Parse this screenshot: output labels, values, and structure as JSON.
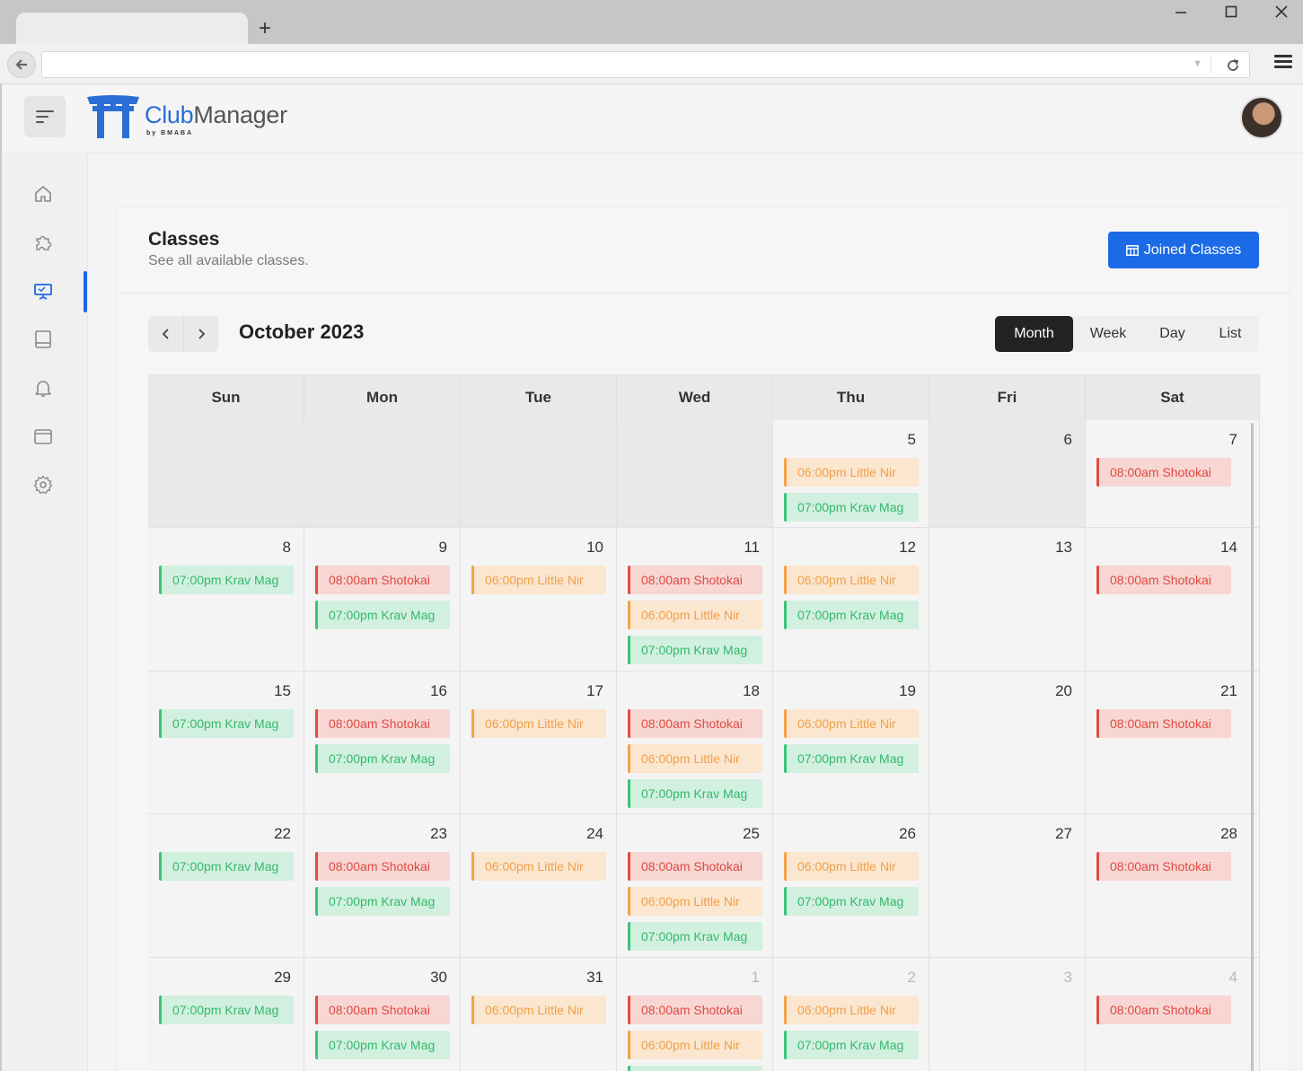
{
  "browser": {
    "new_tab": "+",
    "win_minimize": "—",
    "win_maximize": "☐",
    "win_close": "✕"
  },
  "app": {
    "logo_club": "Club",
    "logo_manager": "Manager",
    "logo_byline": "by BMABA"
  },
  "sidebar": {
    "items": [
      {
        "name": "home",
        "icon": "home-icon"
      },
      {
        "name": "puzzle",
        "icon": "puzzle-icon"
      },
      {
        "name": "classes",
        "icon": "presentation-icon",
        "active": true
      },
      {
        "name": "notebook",
        "icon": "notebook-icon"
      },
      {
        "name": "notifications",
        "icon": "bell-icon"
      },
      {
        "name": "wallet",
        "icon": "wallet-icon"
      },
      {
        "name": "settings",
        "icon": "gear-icon"
      }
    ]
  },
  "page": {
    "title": "Classes",
    "subtitle": "See all available classes.",
    "joined_button": "Joined Classes"
  },
  "calendar": {
    "month_label": "October 2023",
    "views": [
      "Month",
      "Week",
      "Day",
      "List"
    ],
    "active_view": "Month",
    "weekdays": [
      "Sun",
      "Mon",
      "Tue",
      "Wed",
      "Thu",
      "Fri",
      "Sat"
    ],
    "weeks": [
      [
        {
          "day": "",
          "blank": true,
          "events": []
        },
        {
          "day": "",
          "blank": true,
          "events": []
        },
        {
          "day": "",
          "blank": true,
          "events": []
        },
        {
          "day": "",
          "blank": true,
          "events": []
        },
        {
          "day": "5",
          "events": [
            "o",
            "g"
          ]
        },
        {
          "day": "6",
          "blank": true,
          "events": []
        },
        {
          "day": "7",
          "events": [
            "r"
          ]
        }
      ],
      [
        {
          "day": "8",
          "events": [
            "g"
          ]
        },
        {
          "day": "9",
          "events": [
            "r",
            "g"
          ]
        },
        {
          "day": "10",
          "events": [
            "o"
          ]
        },
        {
          "day": "11",
          "events": [
            "r",
            "o",
            "g"
          ]
        },
        {
          "day": "12",
          "events": [
            "o",
            "g"
          ]
        },
        {
          "day": "13",
          "events": []
        },
        {
          "day": "14",
          "events": [
            "r"
          ]
        }
      ],
      [
        {
          "day": "15",
          "events": [
            "g"
          ]
        },
        {
          "day": "16",
          "events": [
            "r",
            "g"
          ]
        },
        {
          "day": "17",
          "events": [
            "o"
          ]
        },
        {
          "day": "18",
          "events": [
            "r",
            "o",
            "g"
          ]
        },
        {
          "day": "19",
          "events": [
            "o",
            "g"
          ]
        },
        {
          "day": "20",
          "events": []
        },
        {
          "day": "21",
          "events": [
            "r"
          ]
        }
      ],
      [
        {
          "day": "22",
          "events": [
            "g"
          ]
        },
        {
          "day": "23",
          "events": [
            "r",
            "g"
          ]
        },
        {
          "day": "24",
          "events": [
            "o"
          ]
        },
        {
          "day": "25",
          "events": [
            "r",
            "o",
            "g"
          ]
        },
        {
          "day": "26",
          "events": [
            "o",
            "g"
          ]
        },
        {
          "day": "27",
          "events": []
        },
        {
          "day": "28",
          "events": [
            "r"
          ]
        }
      ],
      [
        {
          "day": "29",
          "events": [
            "g"
          ]
        },
        {
          "day": "30",
          "events": [
            "r",
            "g"
          ]
        },
        {
          "day": "31",
          "events": [
            "o"
          ]
        },
        {
          "day": "1",
          "other": true,
          "events": [
            "r",
            "o",
            "g"
          ]
        },
        {
          "day": "2",
          "other": true,
          "events": [
            "o",
            "g"
          ]
        },
        {
          "day": "3",
          "other": true,
          "events": []
        },
        {
          "day": "4",
          "other": true,
          "events": [
            "r"
          ]
        }
      ]
    ],
    "event_types": {
      "r": {
        "label": "08:00am Shotokai",
        "color": "#e24c42"
      },
      "o": {
        "label": "06:00pm Little Nir",
        "color": "#f3a24a"
      },
      "g": {
        "label": "07:00pm Krav Mag",
        "color": "#3cc37a"
      }
    }
  },
  "colors": {
    "accent": "#1b6ae6",
    "active_view_bg": "#232323"
  }
}
